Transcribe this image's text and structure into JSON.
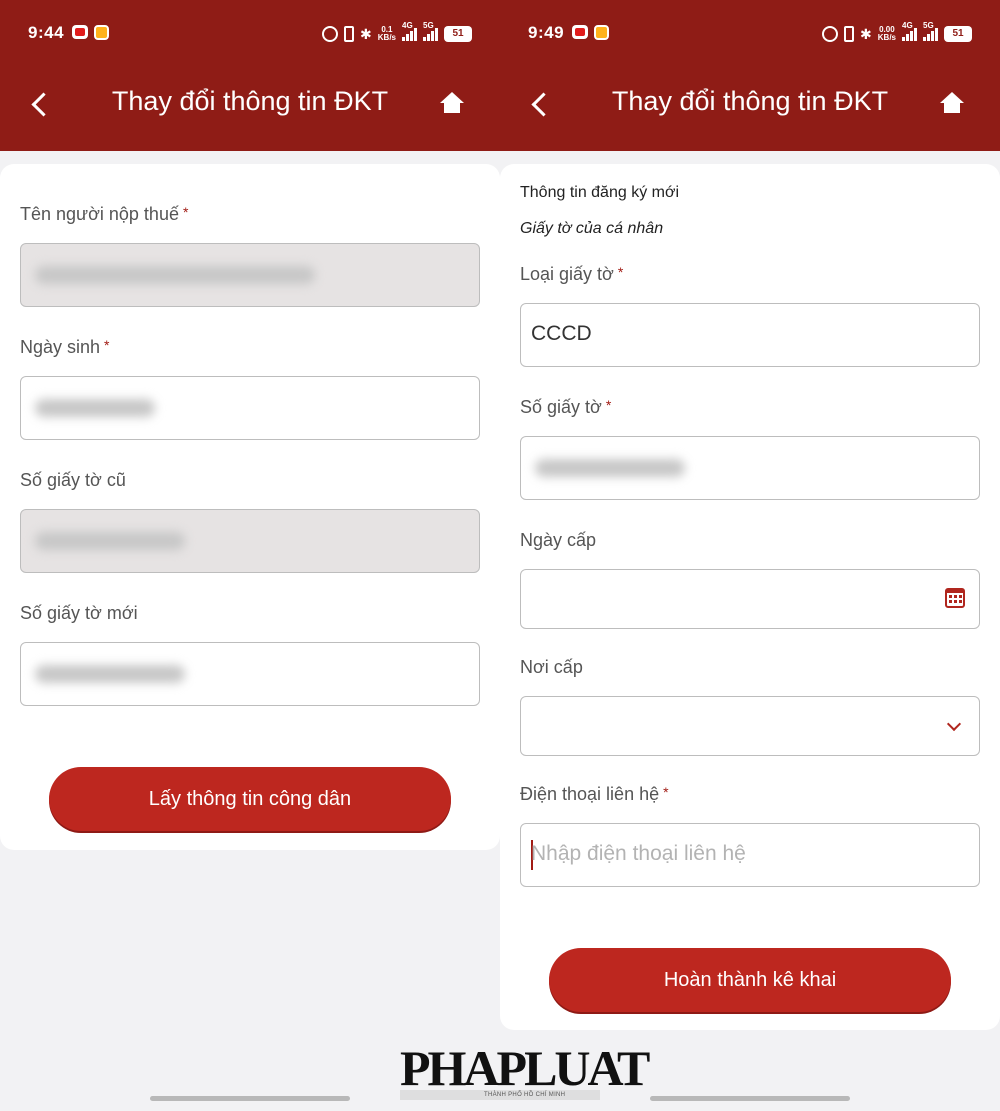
{
  "left_screen": {
    "status": {
      "time": "9:44",
      "net_speed": "0.1",
      "net_unit": "KB/s",
      "sim1": "4G",
      "sim2": "5G",
      "battery": "51"
    },
    "nav": {
      "title": "Thay đổi thông tin ĐKT"
    },
    "fields": {
      "taxpayer_name_label": "Tên người nộp thuế",
      "dob_label": "Ngày sinh",
      "old_id_label": "Số giấy tờ cũ",
      "new_id_label": "Số giấy tờ mới",
      "required_mark": "*"
    },
    "button_label": "Lấy thông tin công dân"
  },
  "right_screen": {
    "status": {
      "time": "9:49",
      "net_speed": "0.00",
      "net_unit": "KB/s",
      "sim1": "4G",
      "sim2": "5G",
      "battery": "51"
    },
    "nav": {
      "title": "Thay đổi thông tin ĐKT"
    },
    "section_title": "Thông tin đăng ký mới",
    "section_subtitle": "Giấy tờ của cá nhân",
    "fields": {
      "doc_type_label": "Loại giấy tờ",
      "doc_type_value": "CCCD",
      "doc_number_label": "Số giấy tờ",
      "issue_date_label": "Ngày cấp",
      "issue_place_label": "Nơi cấp",
      "phone_label": "Điện thoại liên hệ",
      "phone_placeholder": "Nhập điện thoại liên hệ",
      "required_mark": "*"
    },
    "button_label": "Hoàn thành kê khai"
  },
  "watermark": {
    "text": "PHAPLUAT",
    "sub": "THÀNH PHỐ HỒ CHÍ MINH"
  },
  "colors": {
    "header": "#8f1c16",
    "button": "#bd271f",
    "accent": "#a11b14"
  }
}
